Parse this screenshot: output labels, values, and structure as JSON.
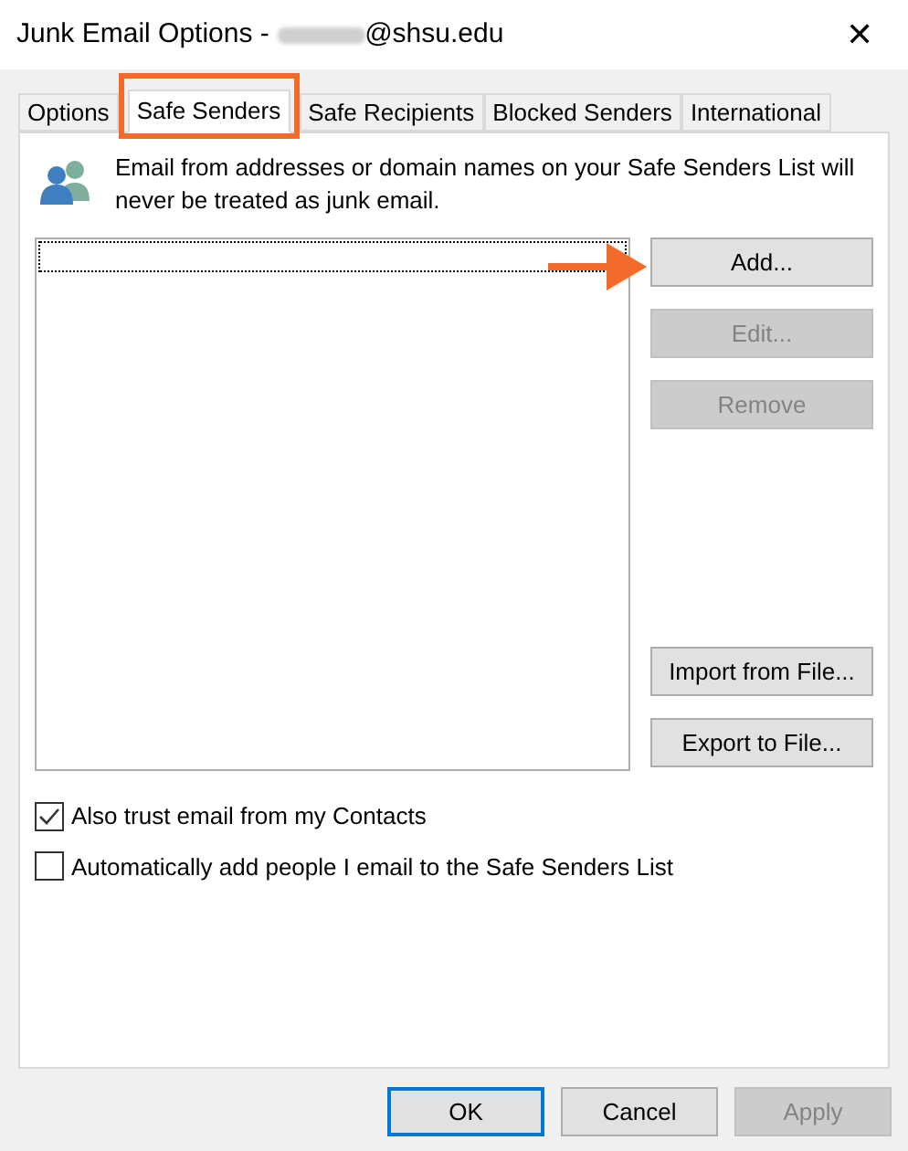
{
  "window": {
    "title": "Junk Email Options - ",
    "title_suffix": "@shsu.edu",
    "close": "✕"
  },
  "tabs": [
    {
      "label": "Options",
      "selected": false,
      "highlighted": false
    },
    {
      "label": "Safe Senders",
      "selected": true,
      "highlighted": true
    },
    {
      "label": "Safe Recipients",
      "selected": false,
      "highlighted": false
    },
    {
      "label": "Blocked Senders",
      "selected": false,
      "highlighted": false
    },
    {
      "label": "International",
      "selected": false,
      "highlighted": false
    }
  ],
  "description": "Email from addresses or domain names on your Safe Senders List will never be treated as junk email.",
  "list": {
    "focused": true
  },
  "arrow_annotation": true,
  "side_buttons": [
    {
      "label": "Add...",
      "disabled": false
    },
    {
      "label": "Edit...",
      "disabled": true
    },
    {
      "label": "Remove",
      "disabled": true
    },
    {
      "label": "Import from File...",
      "disabled": false
    },
    {
      "label": "Export to File...",
      "disabled": false
    }
  ],
  "options": [
    {
      "label": "Also trust email from my Contacts",
      "checked": true
    },
    {
      "label": "Automatically add people I email to the Safe Senders List",
      "checked": false
    }
  ],
  "footer_buttons": [
    {
      "label": "OK",
      "disabled": false,
      "default": true
    },
    {
      "label": "Cancel",
      "disabled": false,
      "default": false
    },
    {
      "label": "Apply",
      "disabled": true,
      "default": false
    }
  ]
}
